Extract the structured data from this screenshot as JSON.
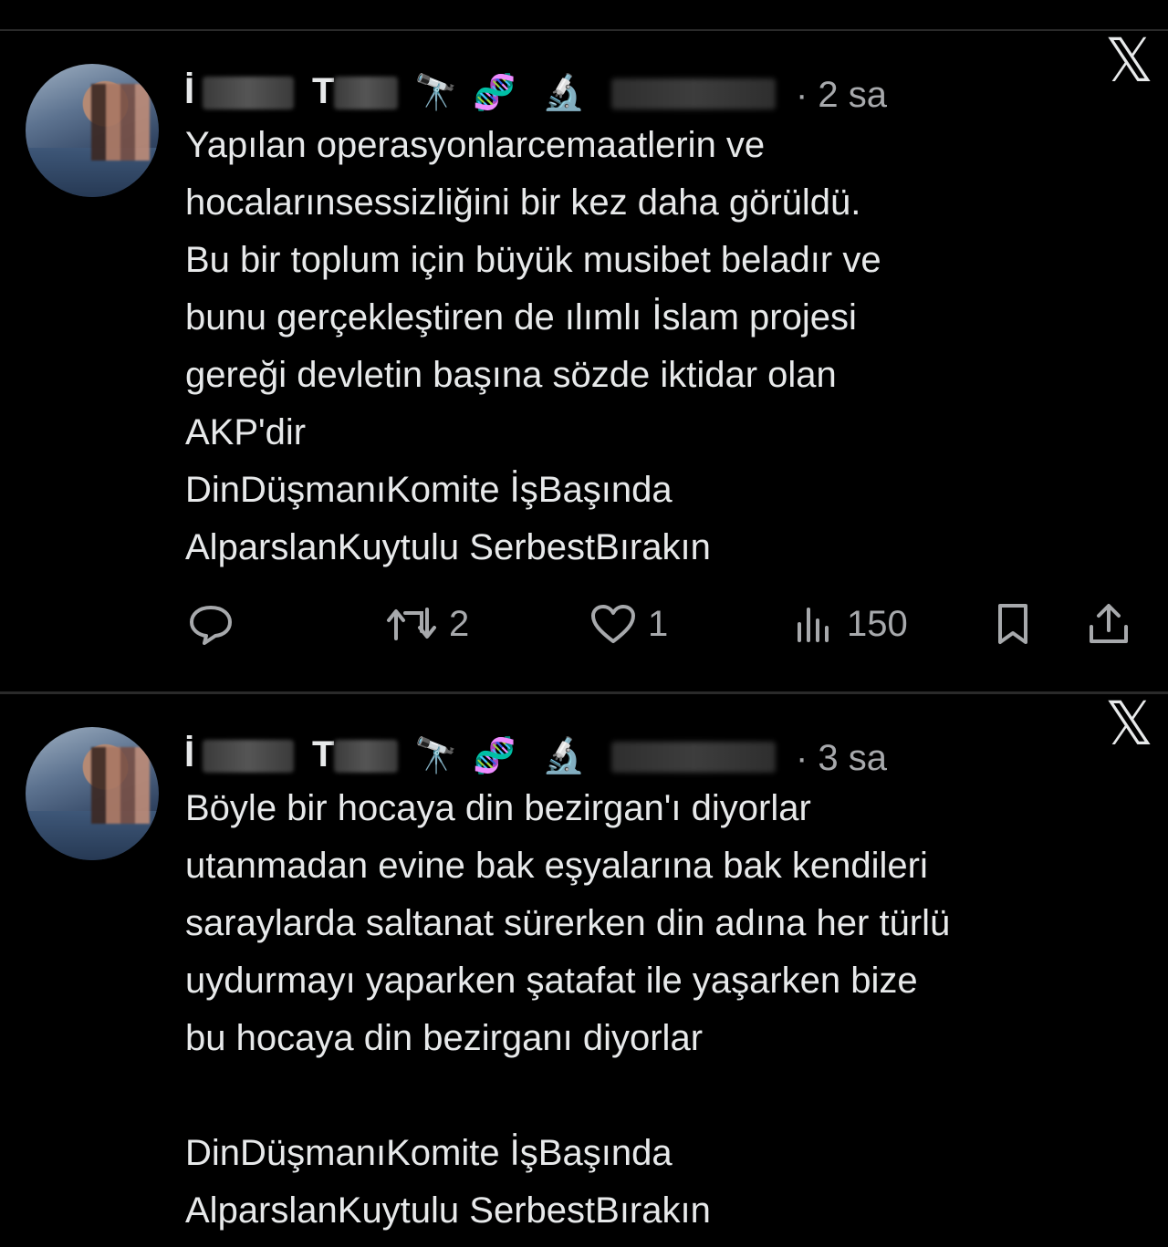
{
  "tweets": [
    {
      "name_initial_1": "İ",
      "name_initial_2": "T",
      "emojis": [
        "🔭",
        "🧬",
        "🔬"
      ],
      "time": "· 2 sa",
      "text": "Yapılan operasyonlarcemaatlerin ve\nhocalarınsessizliğini bir kez daha görüldü.\nBu bir toplum için büyük musibet beladır ve\nbunu gerçekleştiren de  ılımlı İslam projesi\ngereği devletin başına sözde iktidar olan\nAKP'dir\nDinDüşmanıKomite İşBaşında\nAlparslanKuytulu SerbestBırakın",
      "actions": {
        "reply": "",
        "retweet": "2",
        "like": "1",
        "views": "150"
      }
    },
    {
      "name_initial_1": "İ",
      "name_initial_2": "T",
      "emojis": [
        "🔭",
        "🧬",
        "🔬"
      ],
      "time": "· 3 sa",
      "text": "Böyle bir hocaya din bezirgan'ı diyorlar\nutanmadan evine bak eşyalarına bak kendileri\nsaraylarda saltanat sürerken din adına her türlü\nuydurmayı yaparken şatafat ile yaşarken bize\nbu hocaya din bezirganı diyorlar\n\nDinDüşmanıKomite İşBaşında\nAlparslanKuytulu SerbestBırakın"
    }
  ],
  "brand": {
    "logo": "𝕏"
  },
  "colors": {
    "background": "#000000",
    "text": "#e7e9ea",
    "muted": "#a7a9ac"
  }
}
